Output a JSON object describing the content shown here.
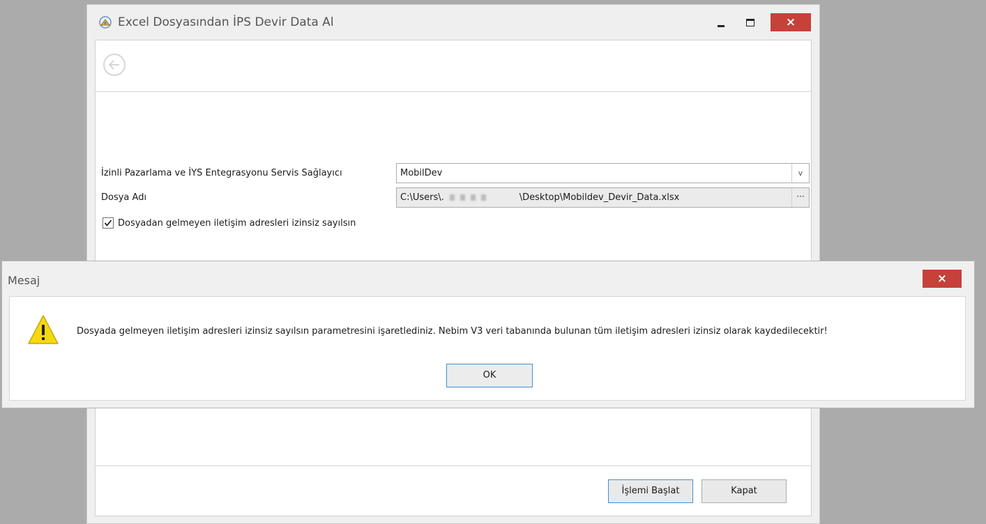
{
  "main_window": {
    "title": "Excel Dosyasından İPS Devir Data Al",
    "close_glyph": "×",
    "icon": "app-icon",
    "back_icon": "back-arrow-icon"
  },
  "form": {
    "provider_label": "İzinli Pazarlama ve İYS Entegrasyonu Servis Sağlayıcı",
    "provider_value": "MobilDev",
    "provider_dropdown_glyph": "v",
    "file_label": "Dosya Adı",
    "file_path_start": "C:\\Users\\.",
    "file_path_end": "\\Desktop\\Mobildev_Devir_Data.xlsx",
    "browse_glyph": "···",
    "checkbox_label": "Dosyadan gelmeyen iletişim adresleri izinsiz sayılsın",
    "checkbox_checked": true
  },
  "buttons": {
    "start": "İşlemi Başlat",
    "close": "Kapat"
  },
  "dialog": {
    "title": "Mesaj",
    "close_glyph": "×",
    "icon": "warning-icon",
    "message": "Dosyada gelmeyen iletişim adresleri izinsiz sayılsın parametresini işaretlediniz. Nebim V3 veri tabanında bulunan tüm iletişim adresleri izinsiz olarak kaydedilecektir!",
    "ok": "OK"
  },
  "colors": {
    "close_red": "#c7403a",
    "focus_blue": "#3f8fd8",
    "warning_yellow": "#f5d90f"
  }
}
